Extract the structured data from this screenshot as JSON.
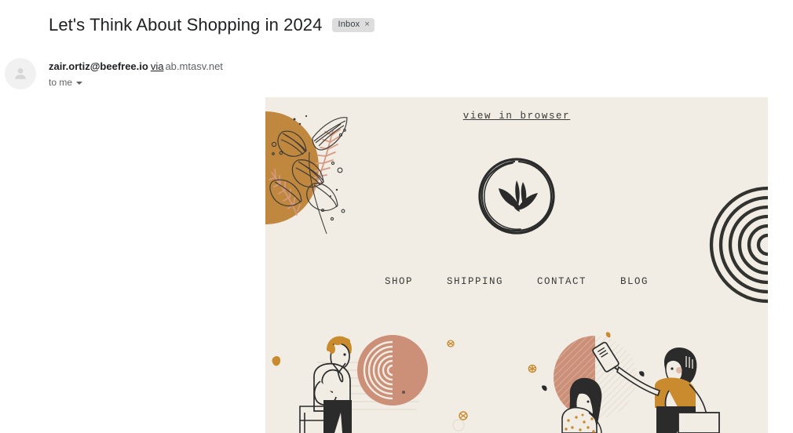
{
  "mail": {
    "subject": "Let's Think About Shopping in 2024",
    "label": {
      "name": "Inbox",
      "close_icon": "×"
    },
    "sender": {
      "email": "zair.ortiz@beefree.io",
      "via": "via",
      "domain": "ab.mtasv.net"
    },
    "recipient": "to me",
    "avatar_icon": "person-placeholder-icon",
    "caret_icon": "chevron-down-icon"
  },
  "newsletter": {
    "view_in_browser": "view in browser",
    "logo_icon": "sketched-circle-leaves-logo",
    "nav": [
      {
        "label": "SHOP"
      },
      {
        "label": "SHIPPING"
      },
      {
        "label": "CONTACT"
      },
      {
        "label": "BLOG"
      }
    ],
    "decor": {
      "botanical_icon": "botanical-leaves-illustration",
      "rings_icon": "concentric-rings-illustration",
      "hero_icon": "shoppers-illustration"
    },
    "colors": {
      "background": "#f1ede5",
      "ochre": "#c0873f",
      "salmon": "#cc8f77",
      "ink": "#2b2b2b",
      "mustard": "#c98b2e"
    }
  }
}
